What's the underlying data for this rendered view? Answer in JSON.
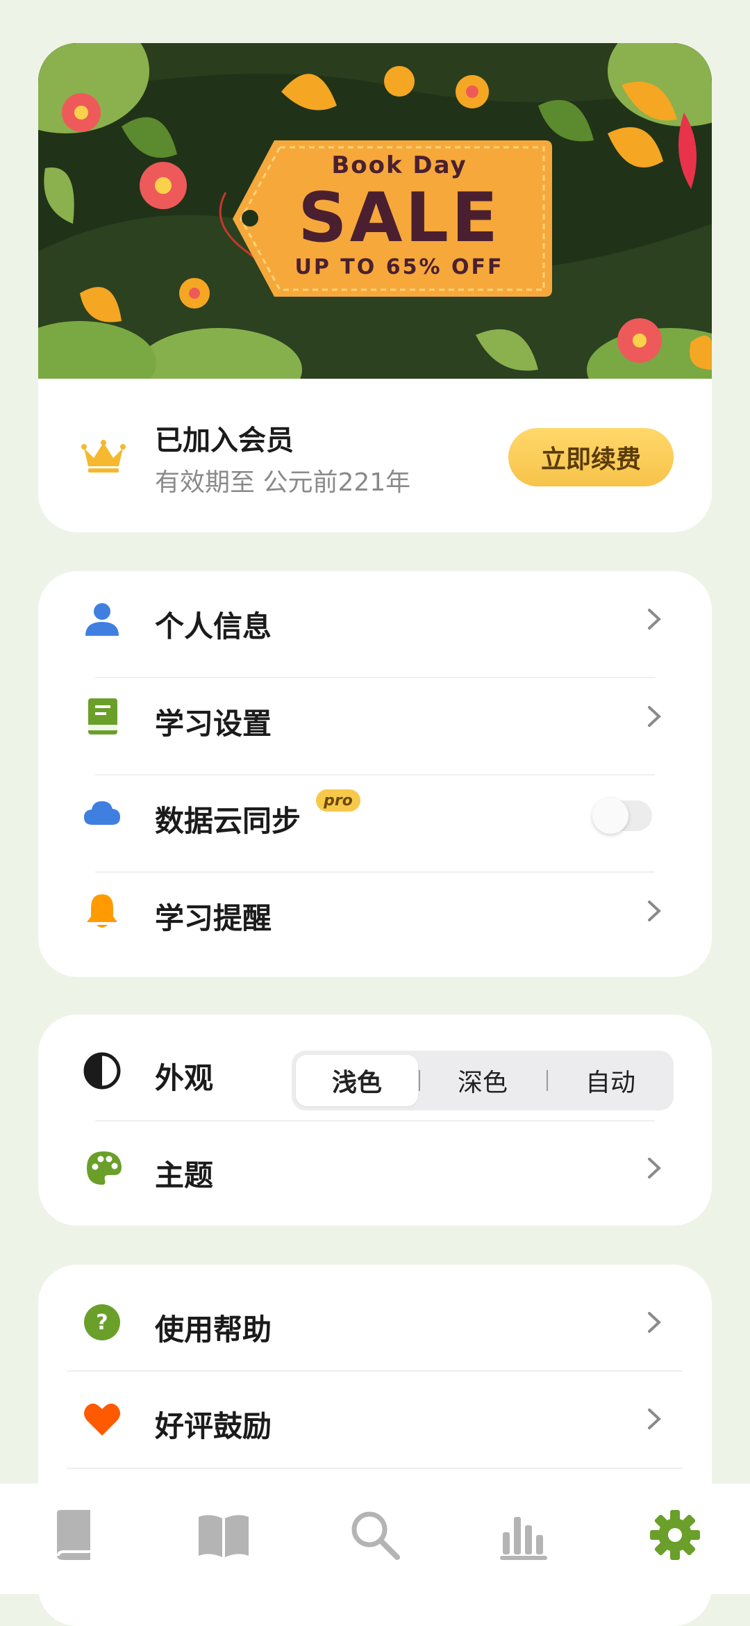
{
  "banner": {
    "line1": "Book Day",
    "line2": "SALE",
    "line3": "UP TO 65% OFF"
  },
  "membership": {
    "title": "已加入会员",
    "subtitle": "有效期至 公元前221年",
    "renew_label": "立即续费",
    "icon": "crown-icon"
  },
  "settings": {
    "profile_label": "个人信息",
    "study_settings_label": "学习设置",
    "cloud_sync_label": "数据云同步",
    "pro_badge": "pro",
    "cloud_sync_enabled": false,
    "reminder_label": "学习提醒"
  },
  "appearance": {
    "label": "外观",
    "options": [
      "浅色",
      "深色",
      "自动"
    ],
    "selected": "浅色",
    "theme_label": "主题"
  },
  "help": {
    "help_label": "使用帮助",
    "rate_label": "好评鼓励"
  },
  "tabbar": {
    "tabs": [
      "book-icon",
      "open-book-icon",
      "search-icon",
      "stats-icon",
      "gear-icon"
    ],
    "active": "gear-icon"
  },
  "colors": {
    "background": "#eef3e7",
    "accent_green": "#6a9f2a",
    "accent_yellow": "#f7c94b",
    "blue": "#3f7fe0",
    "orange": "#ff9a00",
    "red_heart": "#ff5a00"
  }
}
